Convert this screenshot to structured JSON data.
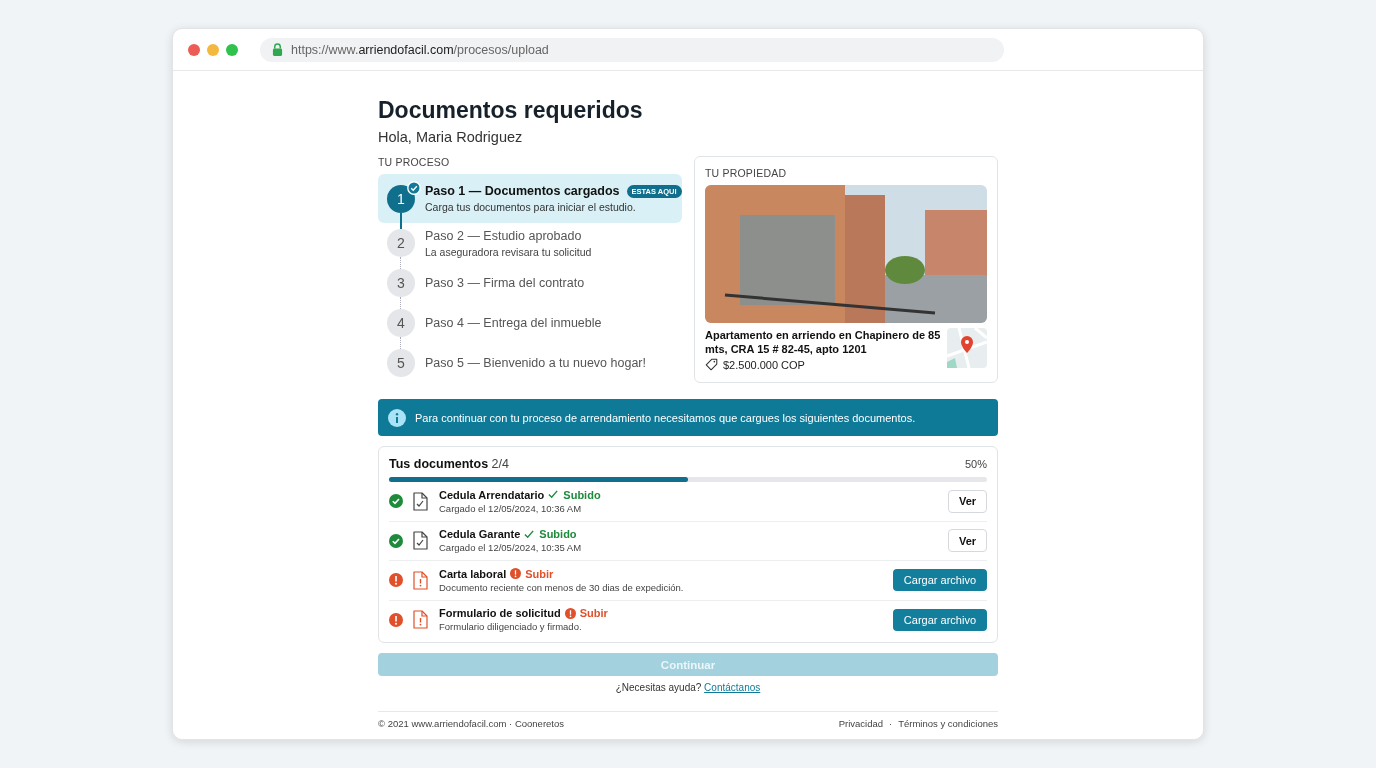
{
  "browser": {
    "url": "https://www.**arriendofacil.com**/procesos/upload"
  },
  "page": {
    "title": "Documentos requeridos",
    "greeting": "Hola, Maria Rodriguez"
  },
  "process": {
    "heading": "TU PROCESO",
    "steps": [
      {
        "number": "1",
        "title": "Paso 1 — Documentos cargados",
        "subtitle": "Carga tus documentos para iniciar el estudio.",
        "badge": "ESTAS AQUI",
        "selected": true,
        "completed": true
      },
      {
        "number": "2",
        "title": "Paso 2 — Estudio aprobado",
        "subtitle": "La aseguradora revisara tu solicitud",
        "selected": false,
        "completed": false
      },
      {
        "number": "3",
        "title": "Paso 3 — Firma del contrato",
        "selected": false,
        "completed": false
      },
      {
        "number": "4",
        "title": "Paso 4 — Entrega del inmueble",
        "selected": false,
        "completed": false
      },
      {
        "number": "5",
        "title": "Paso 5 — Bienvenido a tu nuevo hogar!",
        "selected": false,
        "completed": false
      }
    ]
  },
  "property": {
    "heading": "TU PROPIEDAD",
    "description": "Apartamento en arriendo en Chapinero de 85 mts, CRA 15 # 82-45, apto 1201",
    "price": "$2.500.000 COP"
  },
  "notice": "Para continuar con tu proceso de arrendamiento necesitamos que cargues los siguientes documentos.",
  "documents": {
    "title": "Tus documentos",
    "count": "2/4",
    "percent": "50%",
    "level": 0.5,
    "items": [
      {
        "kind": "uploaded",
        "name": "Cedula Arrendatario",
        "status": "Subido",
        "detail": "Cargado el 12/05/2024, 10:36 AM",
        "action": "Ver"
      },
      {
        "kind": "uploaded",
        "name": "Cedula Garante",
        "status": "Subido",
        "detail": "Cargado el 12/05/2024, 10:35 AM",
        "action": "Ver"
      },
      {
        "kind": "pending",
        "name": "Carta laboral",
        "status": "Subir",
        "detail": "Documento reciente con menos de 30 dias de expedición.",
        "action": "Cargar archivo"
      },
      {
        "kind": "pending",
        "name": "Formulario de solicitud",
        "status": "Subir",
        "detail": "Formulario diligenciado y firmado.",
        "action": "Cargar archivo"
      }
    ]
  },
  "continue_button": {
    "label": "Continuar",
    "disabled": true
  },
  "help": {
    "text": "¿Necesitas ayuda?",
    "link": "Contáctanos"
  },
  "footer": {
    "copyright": "© 2021 www.arriendofacil.com · Cooneretos",
    "links": [
      "Privacidad",
      "Términos y condiciones"
    ],
    "separator": "·"
  }
}
